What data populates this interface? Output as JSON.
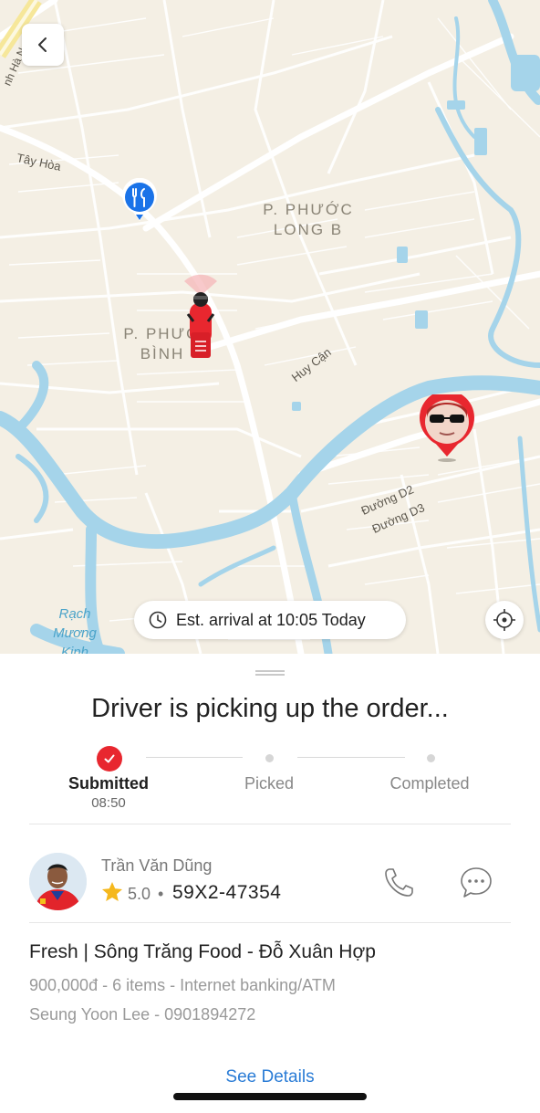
{
  "map": {
    "areas": [
      {
        "id": "phuoc-long-b",
        "line1": "P. PHƯỚC",
        "line2": "LONG B"
      },
      {
        "id": "phuoc-binh",
        "line1": "P. PHƯỚ",
        "line2": "BÌNH"
      }
    ],
    "roads": {
      "tay_hoa": "Tây Hòa",
      "huy_can": "Huy Cận",
      "duong_d2": "Đường D2",
      "duong_d3": "Đường D3",
      "hanoi_hwy_partial": "nh Hà N"
    },
    "water": {
      "line1": "Rạch",
      "line2": "Mương",
      "line3": "Kinh"
    },
    "eta": "Est. arrival at 10:05 Today"
  },
  "sheet": {
    "title": "Driver is picking up the order...",
    "steps": [
      {
        "label": "Submitted",
        "time": "08:50",
        "state": "done"
      },
      {
        "label": "Picked",
        "time": "",
        "state": "pending"
      },
      {
        "label": "Completed",
        "time": "",
        "state": "pending"
      }
    ],
    "driver": {
      "name": "Trần Văn Dũng",
      "rating": "5.0",
      "separator": "•",
      "plate": "59X2-47354"
    },
    "order": {
      "title": "Fresh | Sông Trăng Food - Đỗ Xuân Hợp",
      "meta": "900,000đ - 6 items - Internet banking/ATM",
      "customer": "Seung Yoon Lee - 0901894272"
    },
    "see_details": "See Details"
  },
  "colors": {
    "accent_red": "#e8272f",
    "link_blue": "#2a7cd6",
    "restaurant_pin_blue": "#1a73e8",
    "water": "#a5d4ea",
    "land": "#f4efe4"
  },
  "icons": [
    "back-chevron-icon",
    "restaurant-fork-knife-icon",
    "driver-scooter-icon",
    "customer-location-pin-icon",
    "clock-icon",
    "locate-crosshair-icon",
    "checkmark-icon",
    "star-icon",
    "phone-icon",
    "chat-bubble-icon"
  ]
}
